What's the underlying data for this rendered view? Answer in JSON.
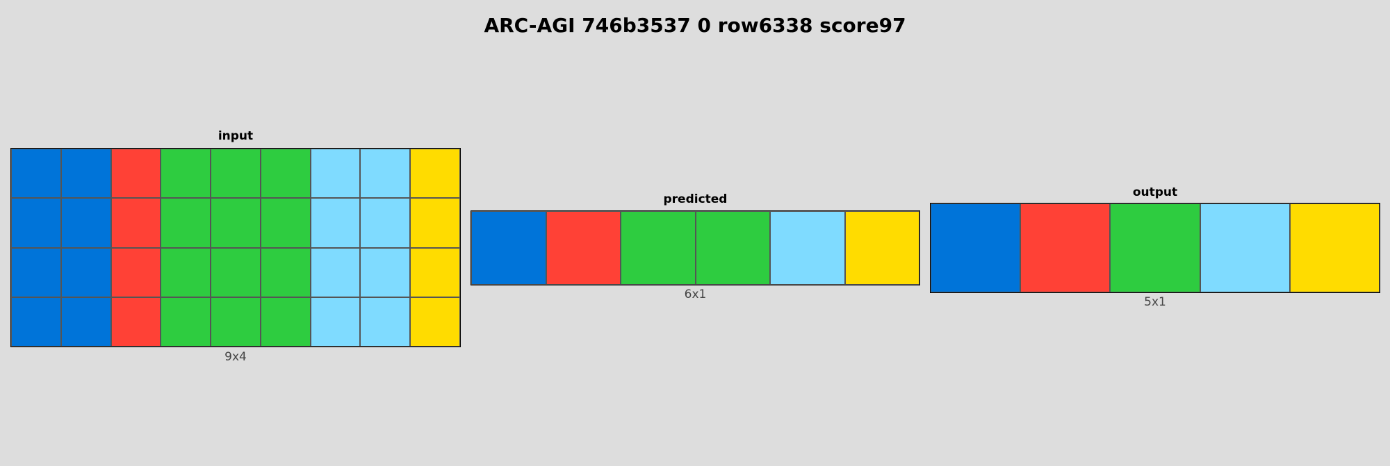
{
  "title": "ARC-AGI 746b3537 0 row6338 score97",
  "palette": {
    "1": "#0074D9",
    "2": "#FF4136",
    "3": "#2ECC40",
    "4": "#FFDC00",
    "8": "#7FDBFF"
  },
  "panels": {
    "input": {
      "label": "input",
      "dims": "9x4",
      "grid": [
        [
          1,
          1,
          2,
          3,
          3,
          3,
          8,
          8,
          4
        ],
        [
          1,
          1,
          2,
          3,
          3,
          3,
          8,
          8,
          4
        ],
        [
          1,
          1,
          2,
          3,
          3,
          3,
          8,
          8,
          4
        ],
        [
          1,
          1,
          2,
          3,
          3,
          3,
          8,
          8,
          4
        ]
      ]
    },
    "predicted": {
      "label": "predicted",
      "dims": "6x1",
      "grid": [
        [
          1,
          2,
          3,
          3,
          8,
          4
        ]
      ]
    },
    "output": {
      "label": "output",
      "dims": "5x1",
      "grid": [
        [
          1,
          2,
          3,
          8,
          4
        ]
      ]
    }
  }
}
